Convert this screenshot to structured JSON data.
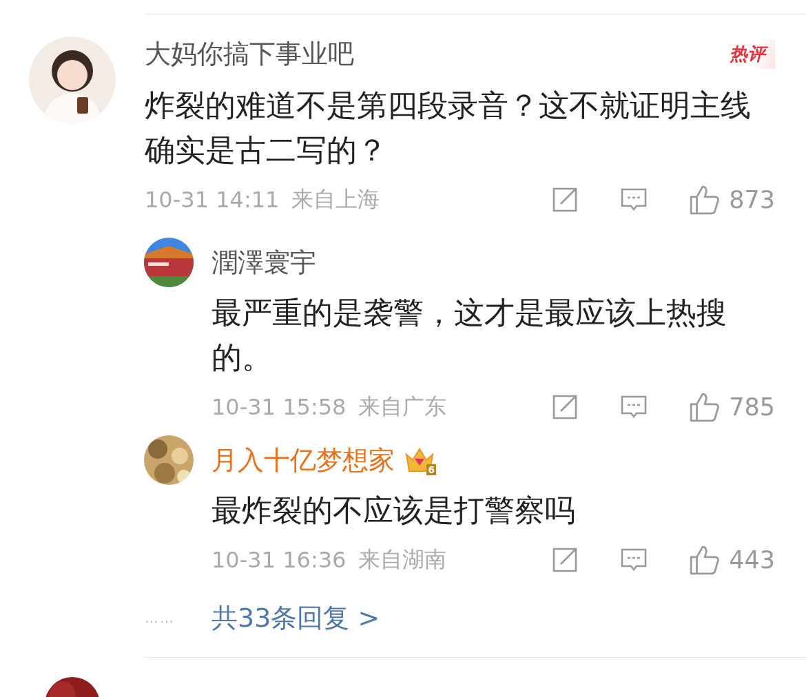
{
  "comments": [
    {
      "avatar": {
        "kind": "picture"
      },
      "name": "大妈你搞下事业吧",
      "hot_badge": "热评",
      "body": "炸裂的难道不是第四段录音？这不就证明主线确实是古二写的？",
      "time": "10-31 14:11",
      "location": "来自上海",
      "likes": "873",
      "replies": [
        {
          "avatar": {
            "kind": "picture"
          },
          "name": "潤澤寰宇",
          "vip": false,
          "body": "最严重的是袭警，这才是最应该上热搜的。",
          "time": "10-31 15:58",
          "location": "来自广东",
          "likes": "785"
        },
        {
          "avatar": {
            "kind": "picture"
          },
          "name": "月入十亿梦想家",
          "vip": true,
          "vip_level": "6",
          "body": "最炸裂的不应该是打警察吗",
          "time": "10-31 16:36",
          "location": "来自湖南",
          "likes": "443"
        }
      ],
      "more_dots": "……",
      "more_replies": "共33条回复 >"
    },
    {
      "avatar": {
        "kind": "picture"
      }
    }
  ]
}
